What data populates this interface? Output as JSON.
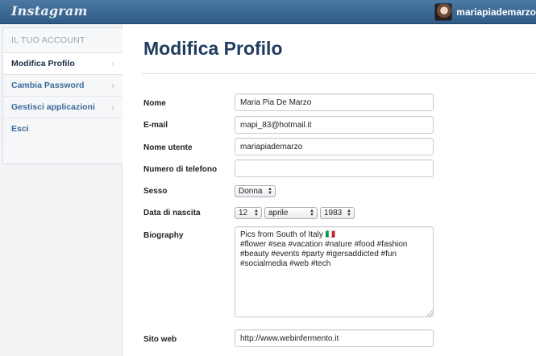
{
  "header": {
    "logo": "Instagram",
    "username": "mariapiademarzo"
  },
  "sidebar": {
    "heading": "IL TUO ACCOUNT",
    "items": [
      {
        "label": "Modifica Profilo",
        "active": true
      },
      {
        "label": "Cambia Password",
        "active": false
      },
      {
        "label": "Gestisci applicazioni",
        "active": false
      },
      {
        "label": "Esci",
        "active": false
      }
    ]
  },
  "main": {
    "title": "Modifica Profilo"
  },
  "form": {
    "name_label": "Nome",
    "name_value": "Maria Pia De Marzo",
    "email_label": "E-mail",
    "email_value": "mapi_83@hotmail.it",
    "username_label": "Nome utente",
    "username_value": "mariapiademarzo",
    "phone_label": "Numero di telefono",
    "phone_value": "",
    "gender_label": "Sesso",
    "gender_value": "Donna",
    "birth_label": "Data di nascita",
    "birth_day": "12",
    "birth_month": "aprile",
    "birth_year": "1983",
    "bio_label": "Biography",
    "bio_value": "Pics from South of Italy 🇮🇹\n#flower #sea #vacation #nature #food #fashion #beauty #events #party #igersaddicted #fun #socialmedia #web #tech",
    "website_label": "Sito web",
    "website_value": "http://www.webinfermento.it"
  },
  "colors": {
    "topbar": "#3a6794",
    "title": "#1e3c5e",
    "link": "#3b6a98"
  }
}
